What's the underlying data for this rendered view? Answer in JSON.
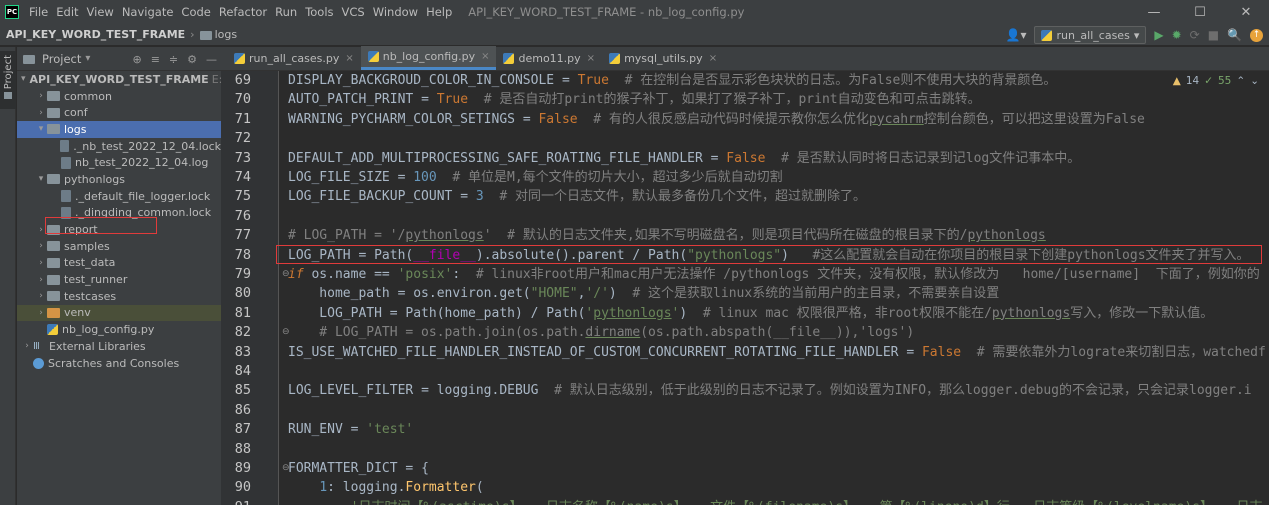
{
  "window": {
    "title": "API_KEY_WORD_TEST_FRAME - nb_log_config.py",
    "logo": "PC",
    "minimize": "—",
    "maximize": "☐",
    "close": "✕"
  },
  "menu": [
    "File",
    "Edit",
    "View",
    "Navigate",
    "Code",
    "Refactor",
    "Run",
    "Tools",
    "VCS",
    "Window",
    "Help"
  ],
  "breadcrumb": {
    "project": "API_KEY_WORD_TEST_FRAME",
    "folder": "logs",
    "separator": "›"
  },
  "toolbar": {
    "run_config": "run_all_cases",
    "run_config_arrow": "▾",
    "user_icon": "👤▾",
    "run_icon": "▶",
    "debug_icon": "✹",
    "coverage_icon": "⟳",
    "stop_icon": "■",
    "search_icon": "🔍",
    "update_icon": "↑"
  },
  "project_panel": {
    "title": "Project",
    "title_arrow": "▾",
    "tool_icons": [
      "⊕",
      "≡",
      "≑",
      "⚙",
      "—"
    ],
    "tree": [
      {
        "level": 0,
        "arrow": "▾",
        "icon": "folder",
        "label": "API_KEY_WORD_TEST_FRAME",
        "hint": "E:\\"
      },
      {
        "level": 1,
        "arrow": "›",
        "icon": "folder",
        "label": "common"
      },
      {
        "level": 1,
        "arrow": "›",
        "icon": "folder",
        "label": "conf"
      },
      {
        "level": 1,
        "arrow": "▾",
        "icon": "folder",
        "label": "logs",
        "selected": true
      },
      {
        "level": 2,
        "arrow": "",
        "icon": "file",
        "label": "._nb_test_2022_12_04.lock"
      },
      {
        "level": 2,
        "arrow": "",
        "icon": "file",
        "label": "nb_test_2022_12_04.log"
      },
      {
        "level": 1,
        "arrow": "▾",
        "icon": "folder",
        "label": "pythonlogs",
        "boxed": true
      },
      {
        "level": 2,
        "arrow": "",
        "icon": "file",
        "label": "._default_file_logger.lock"
      },
      {
        "level": 2,
        "arrow": "",
        "icon": "file",
        "label": "._dingding_common.lock"
      },
      {
        "level": 1,
        "arrow": "›",
        "icon": "folder",
        "label": "report"
      },
      {
        "level": 1,
        "arrow": "›",
        "icon": "folder",
        "label": "samples"
      },
      {
        "level": 1,
        "arrow": "›",
        "icon": "folder",
        "label": "test_data"
      },
      {
        "level": 1,
        "arrow": "›",
        "icon": "folder",
        "label": "test_runner"
      },
      {
        "level": 1,
        "arrow": "›",
        "icon": "folder",
        "label": "testcases"
      },
      {
        "level": 1,
        "arrow": "›",
        "icon": "folder-orange",
        "label": "venv",
        "venv": true
      },
      {
        "level": 1,
        "arrow": "",
        "icon": "pyfile",
        "label": "nb_log_config.py"
      },
      {
        "level": 0,
        "arrow": "›",
        "icon": "lib",
        "label": "External Libraries"
      },
      {
        "level": 0,
        "arrow": "",
        "icon": "scratch",
        "label": "Scratches and Consoles"
      }
    ]
  },
  "side_tab": {
    "label": "Project"
  },
  "tabs": [
    {
      "label": "run_all_cases.py",
      "active": false
    },
    {
      "label": "nb_log_config.py",
      "active": true
    },
    {
      "label": "demo11.py",
      "active": false
    },
    {
      "label": "mysql_utils.py",
      "active": false
    }
  ],
  "tab_close": "×",
  "inspection": {
    "warnings": "14",
    "weak": "55",
    "warn_icon": "▲",
    "weak_icon": "✓",
    "up": "⌃",
    "down": "⌄"
  },
  "editor": {
    "line_numbers": [
      "69",
      "70",
      "71",
      "72",
      "73",
      "74",
      "75",
      "76",
      "77",
      "78",
      "79",
      "80",
      "81",
      "82",
      "83",
      "84",
      "85",
      "86",
      "87",
      "88",
      "89",
      "90",
      "91"
    ],
    "highlighted_line": "78"
  }
}
